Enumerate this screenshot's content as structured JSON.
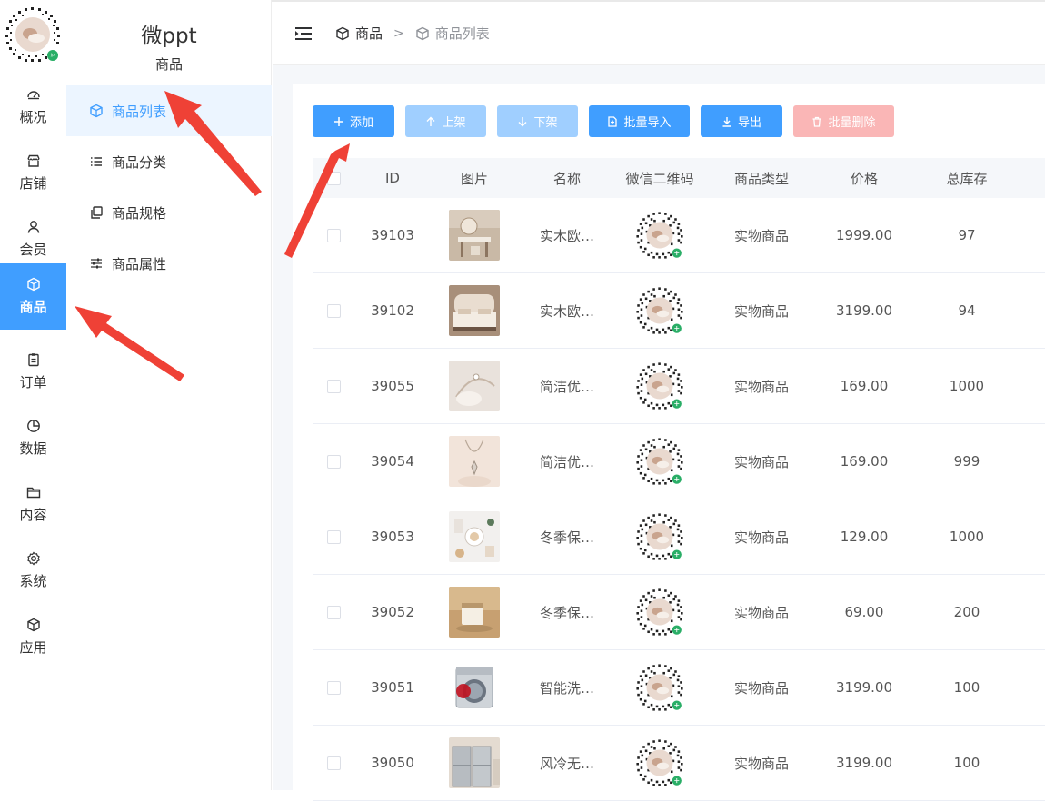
{
  "rail": {
    "items": [
      {
        "label": "概况",
        "icon": "dashboard-icon"
      },
      {
        "label": "店铺",
        "icon": "store-icon"
      },
      {
        "label": "会员",
        "icon": "user-icon"
      },
      {
        "label": "商品",
        "icon": "box-icon",
        "active": true
      },
      {
        "label": "订单",
        "icon": "clipboard-icon"
      },
      {
        "label": "数据",
        "icon": "pie-chart-icon"
      },
      {
        "label": "内容",
        "icon": "folder-icon"
      },
      {
        "label": "系统",
        "icon": "gear-icon"
      },
      {
        "label": "应用",
        "icon": "box-icon"
      }
    ]
  },
  "subnav": {
    "brand": "微ppt",
    "section_title": "商品",
    "items": [
      {
        "label": "商品列表",
        "icon": "box-icon",
        "active": true
      },
      {
        "label": "商品分类",
        "icon": "list-icon"
      },
      {
        "label": "商品规格",
        "icon": "copy-icon"
      },
      {
        "label": "商品属性",
        "icon": "sliders-icon"
      }
    ]
  },
  "breadcrumb": {
    "items": [
      "商品",
      "商品列表"
    ],
    "separator": ">"
  },
  "toolbar": {
    "add": "添加",
    "up": "上架",
    "down": "下架",
    "import": "批量导入",
    "export": "导出",
    "delete": "批量删除"
  },
  "table": {
    "headers": {
      "id": "ID",
      "image": "图片",
      "name": "名称",
      "qr": "微信二维码",
      "type": "商品类型",
      "price": "价格",
      "stock": "总库存"
    },
    "rows": [
      {
        "id": "39103",
        "name": "实木欧…",
        "type": "实物商品",
        "price": "1999.00",
        "stock": "97",
        "thumb": "vanity"
      },
      {
        "id": "39102",
        "name": "实木欧…",
        "type": "实物商品",
        "price": "3199.00",
        "stock": "94",
        "thumb": "bed"
      },
      {
        "id": "39055",
        "name": "简洁优…",
        "type": "实物商品",
        "price": "169.00",
        "stock": "1000",
        "thumb": "bracelet"
      },
      {
        "id": "39054",
        "name": "简洁优…",
        "type": "实物商品",
        "price": "169.00",
        "stock": "999",
        "thumb": "necklace"
      },
      {
        "id": "39053",
        "name": "冬季保…",
        "type": "实物商品",
        "price": "129.00",
        "stock": "1000",
        "thumb": "cosmetics"
      },
      {
        "id": "39052",
        "name": "冬季保…",
        "type": "实物商品",
        "price": "69.00",
        "stock": "200",
        "thumb": "cream"
      },
      {
        "id": "39051",
        "name": "智能洗…",
        "type": "实物商品",
        "price": "3199.00",
        "stock": "100",
        "thumb": "washer"
      },
      {
        "id": "39050",
        "name": "风冷无…",
        "type": "实物商品",
        "price": "3199.00",
        "stock": "100",
        "thumb": "fridge"
      }
    ]
  },
  "colors": {
    "primary": "#409eff",
    "primary_disabled": "#a0cfff",
    "danger_disabled": "#fab6b6",
    "annotation": "#ef4136"
  }
}
